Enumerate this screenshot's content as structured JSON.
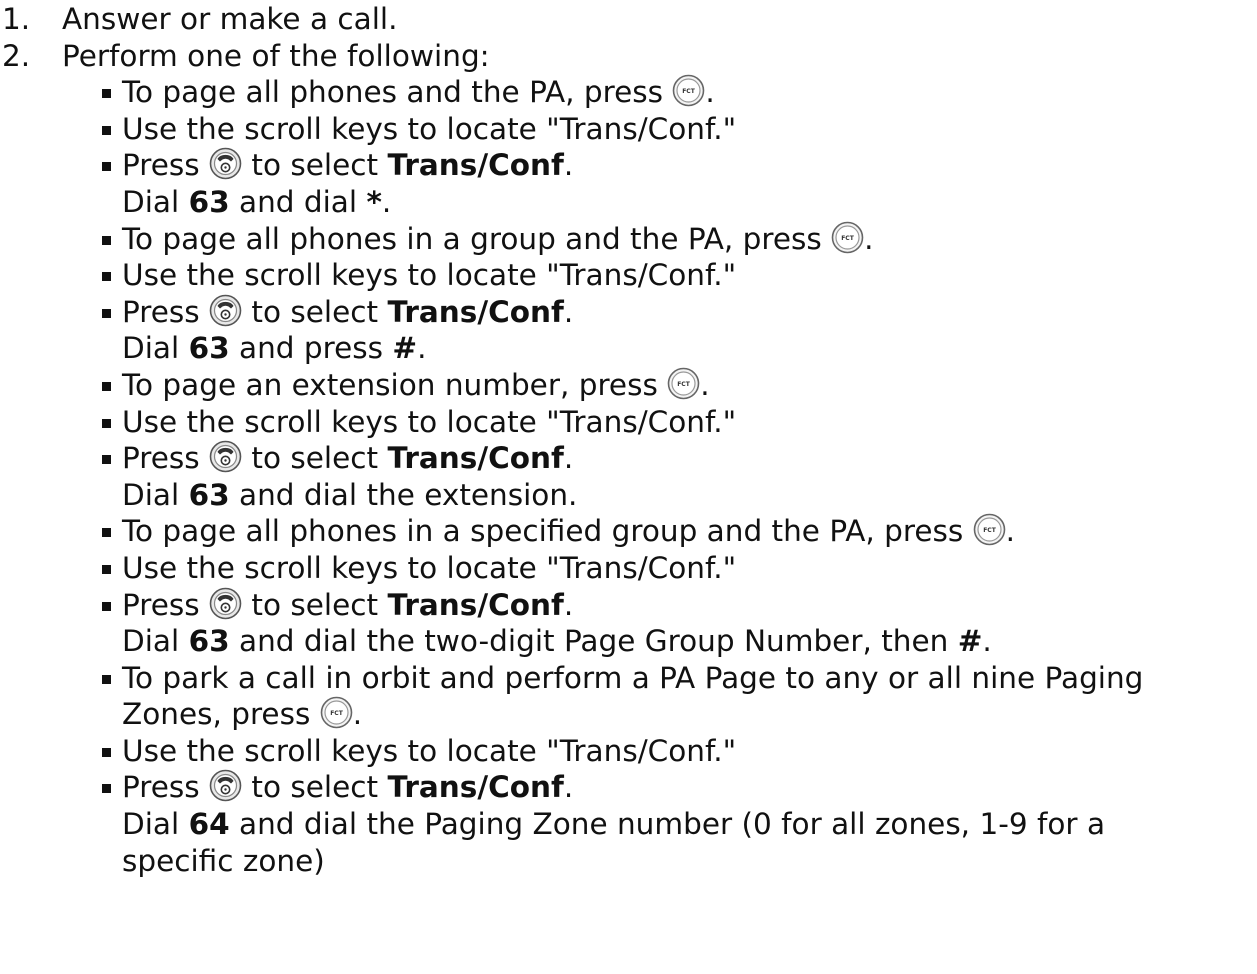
{
  "steps": [
    {
      "num": "1.",
      "text": "Answer or make a call."
    },
    {
      "num": "2.",
      "text": "Perform one of the following:"
    }
  ],
  "icons": {
    "fct": {
      "name": "fct-button-icon",
      "label": "FCT"
    },
    "talk": {
      "name": "talk-button-icon"
    }
  },
  "bullets": {
    "b1": {
      "text": "To page all phones and the PA, press ",
      "end": "."
    },
    "b2": {
      "text": "Use the scroll keys to locate \"Trans/Conf.\""
    },
    "b3": {
      "pre": "Press ",
      "mid": " to select ",
      "bold": "Trans/Conf",
      "end": ".",
      "l2_pre": "Dial ",
      "l2_bold": "63",
      "l2_mid": " and dial ",
      "l2_bold2": "*",
      "l2_end": "."
    },
    "b4": {
      "text": "To page all phones in a group and the PA, press ",
      "end": "."
    },
    "b5": {
      "text": "Use the scroll keys to locate \"Trans/Conf.\""
    },
    "b6": {
      "pre": "Press ",
      "mid": " to select ",
      "bold": "Trans/Conf",
      "end": ".",
      "l2_pre": "Dial ",
      "l2_bold": "63",
      "l2_mid": " and press ",
      "l2_bold2": "#",
      "l2_end": "."
    },
    "b7": {
      "text": "To page an extension number, press ",
      "end": "."
    },
    "b8": {
      "text": "Use the scroll keys to locate \"Trans/Conf.\""
    },
    "b9": {
      "pre": "Press ",
      "mid": " to select ",
      "bold": "Trans/Conf",
      "end": ".",
      "l2_pre": "Dial ",
      "l2_bold": "63",
      "l2_end": " and dial the extension."
    },
    "b10": {
      "text": "To page all phones in a specified group and the PA, press ",
      "end": "."
    },
    "b11": {
      "text": "Use the scroll keys to locate \"Trans/Conf.\""
    },
    "b12": {
      "pre": "Press ",
      "mid": " to select ",
      "bold": "Trans/Conf",
      "end": ".",
      "l2_pre": "Dial ",
      "l2_bold": "63",
      "l2_mid": " and dial the two-digit Page Group Number, then ",
      "l2_bold2": "#",
      "l2_end": "."
    },
    "b13": {
      "text": "To park a call in orbit and perform a PA Page to any or all nine Paging",
      "l2_pre": "Zones, press ",
      "end": "."
    },
    "b14": {
      "text": "Use the scroll keys to locate \"Trans/Conf.\""
    },
    "b15": {
      "pre": "Press ",
      "mid": " to select ",
      "bold": "Trans/Conf",
      "end": ".",
      "l2_pre": "Dial ",
      "l2_bold": "64",
      "l2_end": " and dial the Paging Zone number (0 for all zones, 1-9 for a",
      "l3": "specific zone)"
    }
  }
}
